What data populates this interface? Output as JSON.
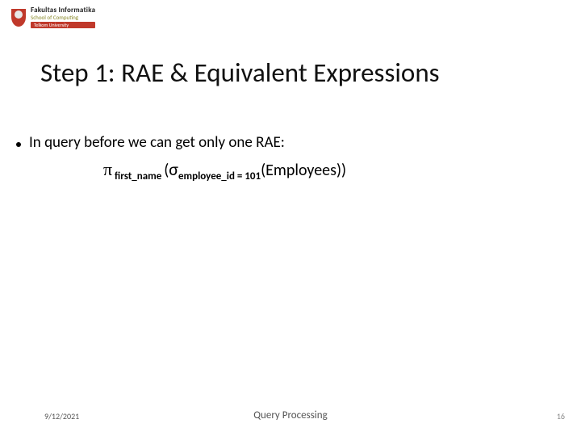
{
  "logo": {
    "line1": "Fakultas Informatika",
    "line2": "School of Computing",
    "line3": "Telkom University"
  },
  "title": "Step 1: RAE & Equivalent Expressions",
  "bullet_text": "In query before we can get only one RAE:",
  "expr": {
    "pi": "π",
    "pi_sub": " first_name ",
    "open1": "(",
    "sigma": "σ",
    "sigma_sub": "employee_id = 101",
    "open2": "(",
    "relation": "Employees",
    "close": "))"
  },
  "footer": {
    "date": "9/12/2021",
    "topic": "Query Processing",
    "page": "16"
  }
}
